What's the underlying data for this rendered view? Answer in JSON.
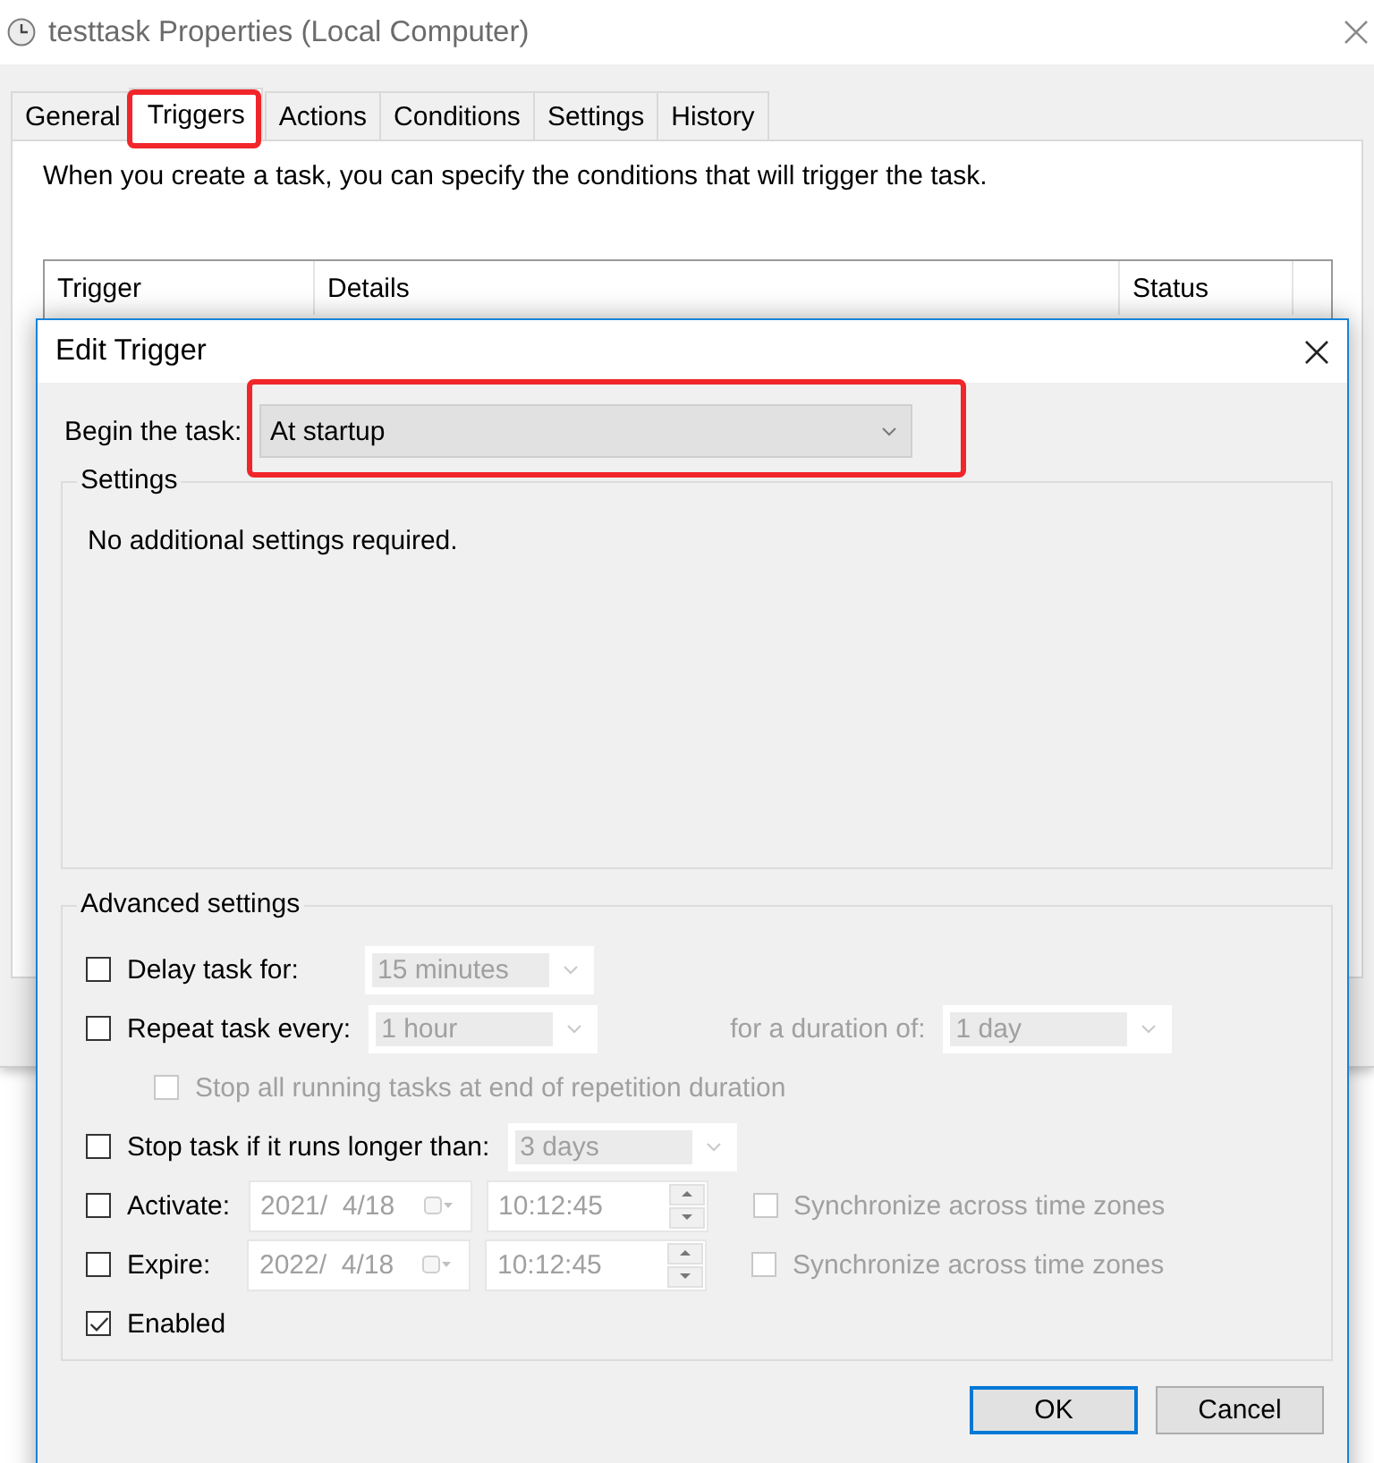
{
  "window": {
    "title": "testtask Properties (Local Computer)"
  },
  "tabs": [
    {
      "label": "General",
      "selected": false,
      "highlighted": false
    },
    {
      "label": "Triggers",
      "selected": true,
      "highlighted": true
    },
    {
      "label": "Actions",
      "selected": false,
      "highlighted": false
    },
    {
      "label": "Conditions",
      "selected": false,
      "highlighted": false
    },
    {
      "label": "Settings",
      "selected": false,
      "highlighted": false
    },
    {
      "label": "History",
      "selected": false,
      "highlighted": false
    }
  ],
  "triggers_panel": {
    "description": "When you create a task, you can specify the conditions that will trigger the task.",
    "columns": [
      "Trigger",
      "Details",
      "Status"
    ]
  },
  "edit_trigger": {
    "title": "Edit Trigger",
    "begin_task": {
      "label": "Begin the task:",
      "value": "At startup",
      "highlighted": true
    },
    "settings": {
      "title": "Settings",
      "message": "No additional settings required."
    },
    "advanced": {
      "title": "Advanced settings",
      "rows": [
        {
          "kind": "choice",
          "label": "Delay task for:",
          "checked": false,
          "disabled": false,
          "field": {
            "value": "15 minutes",
            "disabled": true
          }
        },
        {
          "kind": "choice",
          "label": "Repeat task every:",
          "checked": false,
          "disabled": false,
          "field": {
            "value": "1 hour",
            "disabled": true
          },
          "duration": {
            "label": "for a duration of:",
            "value": "1 day",
            "disabled": true
          }
        },
        {
          "kind": "indented",
          "label": "Stop all running tasks at end of repetition duration",
          "checked": false,
          "disabled": true
        },
        {
          "kind": "choice",
          "label": "Stop task if it runs longer than:",
          "checked": false,
          "disabled": false,
          "field": {
            "value": "3 days",
            "disabled": true
          }
        },
        {
          "kind": "datetime",
          "label": "Activate:",
          "checked": false,
          "disabled": false,
          "date": {
            "value": "2021/  4/18",
            "disabled": true
          },
          "time": {
            "value": "10:12:45",
            "disabled": true
          },
          "sync": {
            "label": "Synchronize across time zones",
            "checked": false,
            "disabled": true
          }
        },
        {
          "kind": "datetime",
          "label": "Expire:",
          "checked": false,
          "disabled": false,
          "date": {
            "value": "2022/  4/18",
            "disabled": true
          },
          "time": {
            "value": "10:12:45",
            "disabled": true
          },
          "sync": {
            "label": "Synchronize across time zones",
            "checked": false,
            "disabled": true
          }
        },
        {
          "kind": "plain",
          "label": "Enabled",
          "checked": true,
          "disabled": false
        }
      ]
    },
    "buttons": [
      {
        "label": "OK",
        "default": true
      },
      {
        "label": "Cancel",
        "default": false
      }
    ]
  }
}
